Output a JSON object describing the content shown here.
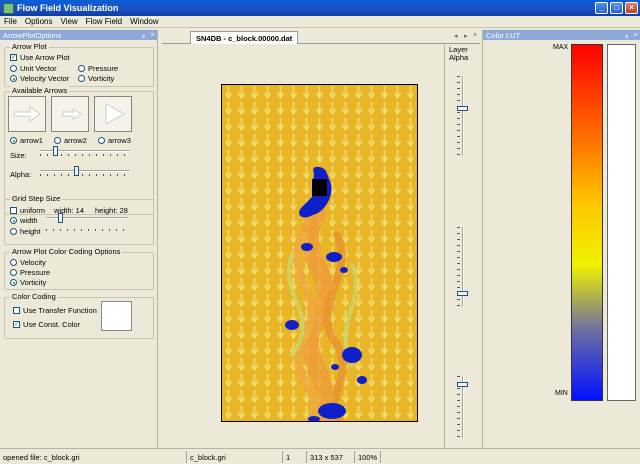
{
  "window": {
    "title": "Flow Field Visualization",
    "minimize": "_",
    "maximize": "□",
    "close": "×"
  },
  "menu": [
    "File",
    "Options",
    "View",
    "Flow Field",
    "Window"
  ],
  "left_panel": {
    "title": "ArrowPlotOptions",
    "pin": "ᵩ",
    "close": "×",
    "arrow_plot": {
      "title": "Arrow Plot",
      "use_arrow_plot": "Use Arrow Plot",
      "use_arrow_plot_checked": true,
      "unit_vector": "Unit Vector",
      "pressure": "Pressure",
      "velocity_vector": "Velocity Vector",
      "vorticity": "Vorticity",
      "selected": "velocity_vector"
    },
    "available_arrows": {
      "title": "Available Arrows",
      "arrows": [
        "arrow1",
        "arrow2",
        "arrow3"
      ],
      "selected": "arrow1",
      "size_label": "Size:",
      "size_value": 0.15,
      "alpha_label": "Alpha:",
      "alpha_value": 0.4
    },
    "grid_step": {
      "title": "Grid Step Size",
      "uniform": "uniform",
      "width_readout": "width: 14",
      "height_readout": "height: 28",
      "width": "width",
      "height": "height",
      "selected": "width",
      "width_slider": 0.15,
      "height_slider": 0.0
    },
    "color_coding_options": {
      "title": "Arrow Plot Color Coding Options",
      "velocity": "Velocity",
      "pressure": "Pressure",
      "vorticity": "Vorticity",
      "selected": "vorticity"
    },
    "color_coding": {
      "title": "Color Coding",
      "use_transfer_function": "Use Transfer Function",
      "use_transfer_function_checked": false,
      "use_const_color": "Use Const. Color",
      "use_const_color_checked": true,
      "const_color": "#ffffff"
    }
  },
  "document": {
    "tab": "SN4DB - c_block.00000.dat",
    "nav_left": "◂",
    "nav_right": "▸",
    "close": "×",
    "colors": {
      "background": "#e8b526",
      "arrow": "#f3e070",
      "streak": "#ef9a3c",
      "vortex": "#1020c8",
      "obstacle": "#000000"
    }
  },
  "layer_panel": {
    "title_line1": "Layer",
    "title_line2": "Alpha",
    "sliders": [
      0.4,
      0.85,
      0.1
    ]
  },
  "right_panel": {
    "title": "Color LUT",
    "pin": "ᵩ",
    "close": "×",
    "max_label": "MAX",
    "min_label": "MIN"
  },
  "status": {
    "message": "opened file: c_block.gri",
    "file": "c_block.gri",
    "index": "1",
    "dimensions": "313 x 537",
    "zoom": "100%"
  }
}
